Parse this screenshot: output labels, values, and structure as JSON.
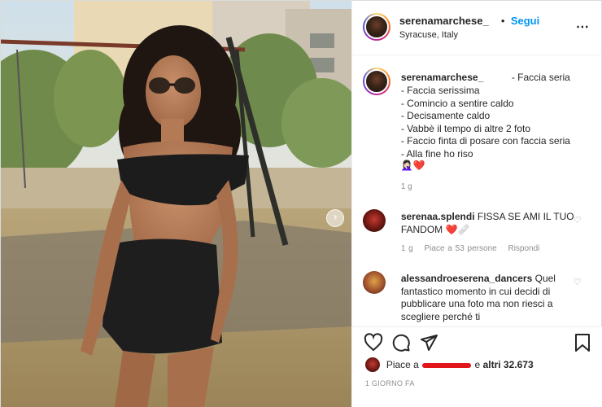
{
  "post": {
    "username": "serenamarchese_",
    "separator": "•",
    "follow_label": "Segui",
    "location": "Syracuse, Italy",
    "more_icon": "⋯",
    "next_icon": "›"
  },
  "caption": {
    "username": "serenamarchese_",
    "title": "- Faccia seria",
    "lines": [
      "- Faccia serissima",
      "- Comincio a sentire caldo",
      "- Decisamente caldo",
      "- Vabbè il tempo di altre 2 foto",
      "- Faccio finta di posare con faccia seria",
      "- Alla fine ho riso"
    ],
    "emojis": "🤦🏻‍♀️❤️",
    "time": "1 g"
  },
  "comments": [
    {
      "username": "serenaa.splendi",
      "text": "FISSA SE AMI IL TUO FANDOM ❤️🩹",
      "time": "1 g",
      "likes": "Piace a 53 persone",
      "reply": "Rispondi"
    },
    {
      "username": "alessandroeserena_dancers",
      "text": "Quel fantastico momento in cui decidi di pubblicare una foto ma non riesci a scegliere perché ti"
    }
  ],
  "actions": {
    "like_icon": "heart-icon",
    "comment_icon": "comment-icon",
    "share_icon": "share-icon",
    "save_icon": "bookmark-icon"
  },
  "likes": {
    "prefix": "Piace a",
    "middle": "e",
    "suffix": "altri 32.673"
  },
  "posted": "1 GIORNO FA",
  "colors": {
    "link_blue": "#0095f6",
    "muted": "#8e8e8e",
    "text": "#262626",
    "redaction": "#e0161b"
  }
}
